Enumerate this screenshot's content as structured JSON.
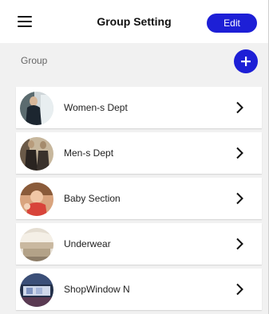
{
  "header": {
    "title": "Group Setting",
    "edit_label": "Edit",
    "menu_icon": "hamburger-menu-icon"
  },
  "section": {
    "label": "Group",
    "add_icon": "plus-icon"
  },
  "colors": {
    "accent": "#1d1fd6",
    "background": "#f1f1f1",
    "card": "#ffffff"
  },
  "groups": [
    {
      "label": "Women-s Dept"
    },
    {
      "label": "Men-s Dept"
    },
    {
      "label": "Baby Section"
    },
    {
      "label": "Underwear"
    },
    {
      "label": "ShopWindow N"
    }
  ]
}
